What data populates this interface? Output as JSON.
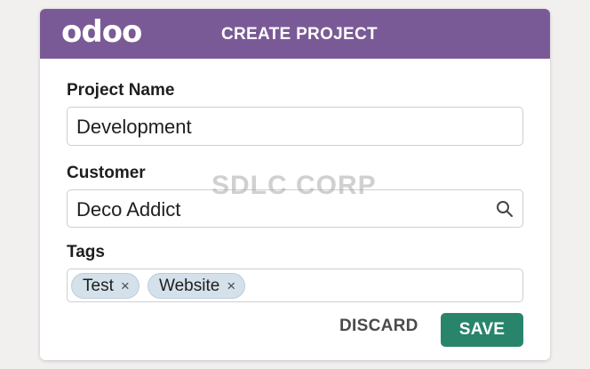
{
  "header": {
    "logo_text": "odoo",
    "title": "CREATE PROJECT",
    "background": "#7a5a96"
  },
  "form": {
    "project_name": {
      "label": "Project Name",
      "value": "Development"
    },
    "customer": {
      "label": "Customer",
      "value": "Deco Addict",
      "icon": "search-icon"
    },
    "tags": {
      "label": "Tags",
      "items": [
        {
          "label": "Test",
          "remove_glyph": "×"
        },
        {
          "label": "Website",
          "remove_glyph": "×"
        }
      ]
    }
  },
  "watermark": "SDLC CORP",
  "actions": {
    "discard_label": "DISCARD",
    "save_label": "SAVE",
    "save_color": "#28856b"
  }
}
